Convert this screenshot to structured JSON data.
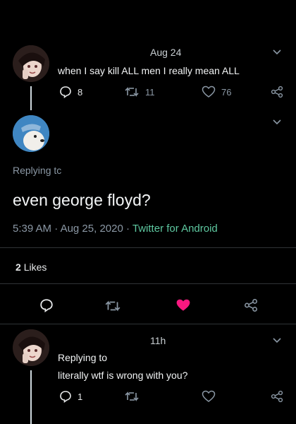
{
  "tweet1": {
    "date": "Aug 24",
    "text": "when I say kill ALL men I really mean ALL",
    "replies": "8",
    "retweets": "11",
    "likes": "76"
  },
  "focus": {
    "replying_label": "Replying tc",
    "text": "even george floyd?",
    "time": "5:39 AM",
    "date": "Aug 25, 2020",
    "source": "Twitter for Android",
    "likes_count": "2",
    "likes_label": "Likes",
    "like_color": "#f91880"
  },
  "reply": {
    "time": "11h",
    "replying_label": "Replying to",
    "text": "literally wtf is wrong with you?",
    "replies": "1"
  }
}
